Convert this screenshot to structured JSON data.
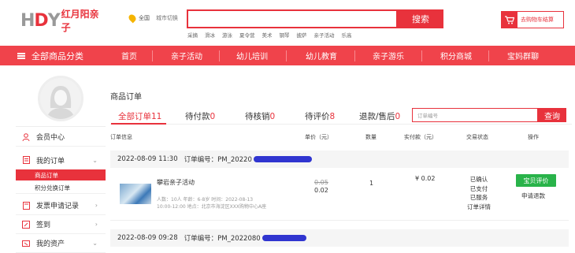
{
  "logo": {
    "mark_left": "H",
    "mark_mid": "D",
    "mark_right": "Y",
    "text": "红月阳亲子"
  },
  "location": {
    "city": "全国",
    "switch_label": "城市切换"
  },
  "search": {
    "button": "搜索",
    "hot": [
      "采摘",
      "滑冰",
      "游泳",
      "夏令营",
      "美术",
      "钢琴",
      "披萨",
      "亲子活动",
      "乐高"
    ]
  },
  "cart": {
    "label": "去购物车结算",
    "icon": "cart-icon"
  },
  "nav": {
    "all_categories": "全部商品分类",
    "items": [
      "首页",
      "亲子活动",
      "幼儿培训",
      "幼儿教育",
      "亲子游乐",
      "积分商城",
      "宝妈群聊"
    ]
  },
  "sidebar": {
    "member_center": "会员中心",
    "my_orders": "我的订单",
    "sub_goods": "商品订单",
    "sub_points": "积分兑换订单",
    "invoice": "发票申请记录",
    "checkin": "签到",
    "assets": "我的资产"
  },
  "main": {
    "title": "商品订单",
    "tabs": [
      {
        "label": "全部订单",
        "count": "11"
      },
      {
        "label": "待付款",
        "count": "0"
      },
      {
        "label": "待核销",
        "count": "0"
      },
      {
        "label": "待评价",
        "count": "8"
      },
      {
        "label": "退款/售后",
        "count": "0"
      }
    ],
    "order_search_placeholder": "订单编号",
    "order_search_button": "查询",
    "headers": [
      "订单信息",
      "单价（元）",
      "数量",
      "实付款（元）",
      "交易状态",
      "操作"
    ]
  },
  "orders": [
    {
      "datetime": "2022-08-09 11:30",
      "order_no": "订单编号：PM_20220",
      "product": "攀岩亲子活动",
      "meta_line1": "人数：10人 年龄：6-8岁 时间：2022-08-13",
      "meta_line2": "10:00-12:00 地点：北京市海淀区XXX购物中心A座",
      "price_original": "0.05",
      "price": "0.02",
      "qty": "1",
      "paid": "¥ 0.02",
      "status": [
        "已确认",
        "已支付",
        "已服务",
        "订单详情"
      ],
      "review_btn": "宝贝评价",
      "refund": "申请退款"
    },
    {
      "datetime": "2022-08-09 09:28",
      "order_no": "订单编号：PM_2022080"
    }
  ]
}
